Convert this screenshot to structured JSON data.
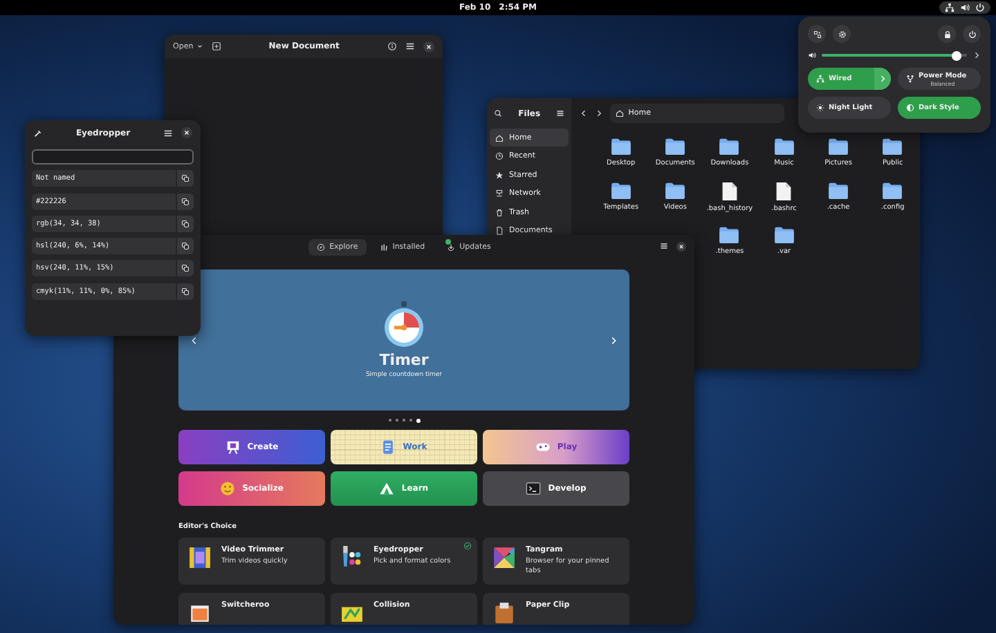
{
  "top_bar": {
    "date": "Feb 10",
    "time": "2:54 PM"
  },
  "text_editor": {
    "open_button": "Open",
    "title": "New Document"
  },
  "files": {
    "title": "Files",
    "path": "Home",
    "sidebar": [
      {
        "label": "Home",
        "selected": true
      },
      {
        "label": "Recent",
        "selected": false
      },
      {
        "label": "Starred",
        "selected": false
      },
      {
        "label": "Network",
        "selected": false
      },
      {
        "label": "Trash",
        "selected": false
      },
      {
        "label": "Documents",
        "selected": false
      }
    ],
    "rows": [
      [
        {
          "name": "Desktop",
          "kind": "folder"
        },
        {
          "name": "Documents",
          "kind": "folder"
        },
        {
          "name": "Downloads",
          "kind": "folder"
        },
        {
          "name": "Music",
          "kind": "folder"
        },
        {
          "name": "Pictures",
          "kind": "folder"
        },
        {
          "name": "Public",
          "kind": "folder"
        }
      ],
      [
        {
          "name": "Templates",
          "kind": "folder"
        },
        {
          "name": "Videos",
          "kind": "folder"
        },
        {
          "name": ".bash_history",
          "kind": "file"
        },
        {
          "name": ".bashrc",
          "kind": "file"
        },
        {
          "name": ".cache",
          "kind": "folder"
        },
        {
          "name": ".config",
          "kind": "folder"
        }
      ],
      [
        "",
        "",
        {
          "name": ".themes",
          "kind": "folder"
        },
        {
          "name": ".var",
          "kind": "folder"
        }
      ]
    ]
  },
  "eyedropper": {
    "title": "Eyedropper",
    "formats": [
      "Not named",
      "#222226",
      "rgb(34, 34, 38)",
      "hsl(240, 6%, 14%)",
      "hsv(240, 11%, 15%)",
      "cmyk(11%, 11%, 0%, 85%)"
    ]
  },
  "software": {
    "tabs": [
      {
        "label": "Explore",
        "selected": true,
        "badge": false
      },
      {
        "label": "Installed",
        "selected": false,
        "badge": false
      },
      {
        "label": "Updates",
        "selected": false,
        "badge": true
      }
    ],
    "featured": {
      "title": "Timer",
      "subtitle": "Simple countdown timer",
      "dots": [
        {
          "selected": false
        },
        {
          "selected": false
        },
        {
          "selected": false
        },
        {
          "selected": false
        },
        {
          "selected": true
        }
      ]
    },
    "categories": [
      "Create",
      "Work",
      "Play",
      "Socialize",
      "Learn",
      "Develop"
    ],
    "section_title": "Editor's Choice",
    "apps": [
      {
        "name": "Video Trimmer",
        "summary": "Trim videos quickly",
        "installed": false
      },
      {
        "name": "Eyedropper",
        "summary": "Pick and format colors",
        "installed": true
      },
      {
        "name": "Tangram",
        "summary": "Browser for your pinned tabs",
        "installed": false
      },
      {
        "name": "Switcheroo",
        "installed": false
      },
      {
        "name": "Collision",
        "installed": false
      },
      {
        "name": "Paper Clip",
        "installed": false
      }
    ]
  },
  "quick_settings": {
    "volume": {
      "level": 0.93
    },
    "toggles": [
      {
        "label": "Wired",
        "on": true,
        "kind": "arrow"
      },
      {
        "label": "Power Mode",
        "sublabel": "Balanced",
        "on": false,
        "kind": "plain"
      },
      {
        "label": "Night Light",
        "on": false,
        "kind": "plain"
      },
      {
        "label": "Dark Style",
        "on": true,
        "kind": "plain"
      }
    ]
  }
}
